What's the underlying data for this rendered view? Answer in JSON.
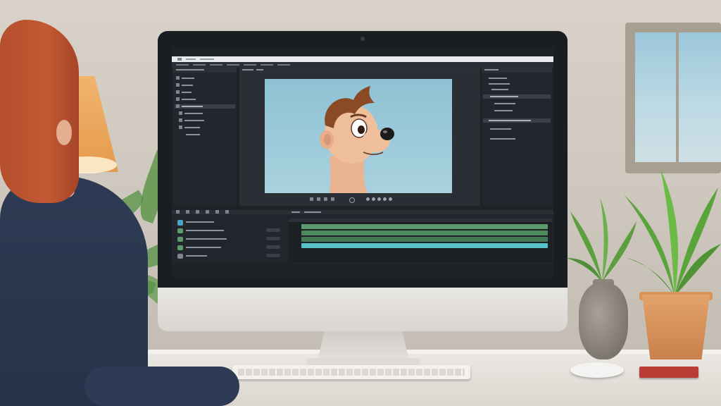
{
  "scene": {
    "description_kind": "photo-style render of a person at a desk using a video editing application",
    "colors": {
      "wall": "#d8d2c9",
      "desk": "#ece8e3",
      "app_bg": "#1e2126",
      "canvas_bg": "#8ec2d4",
      "track_green": "#5c9b6e",
      "track_cyan": "#56c2c9",
      "pot": "#d98c52",
      "lamp": "#eba45c",
      "hair": "#b54e2c",
      "shirt": "#2f3b54"
    }
  },
  "app": {
    "left_panel_items": [
      "",
      "",
      "",
      "",
      "",
      "",
      "",
      "",
      ""
    ],
    "right_panel_items": [
      "",
      "",
      "",
      "",
      "",
      "",
      "",
      ""
    ],
    "timeline_tracks": [
      "",
      "",
      "",
      "",
      ""
    ]
  },
  "icons": {
    "zoom": "magnifier-icon",
    "play": "play-icon",
    "layer": "layer-icon"
  }
}
